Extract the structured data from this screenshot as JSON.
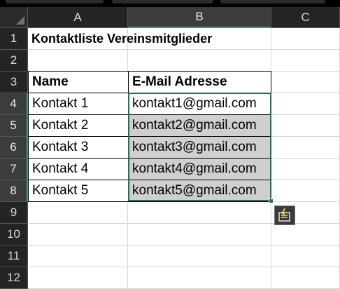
{
  "columns": [
    "A",
    "B",
    "C"
  ],
  "rows": [
    "1",
    "2",
    "3",
    "4",
    "5",
    "6",
    "7",
    "8",
    "9",
    "10",
    "11",
    "12"
  ],
  "selected_column": "B",
  "selected_rows": [
    "4",
    "5",
    "6",
    "7",
    "8"
  ],
  "sheet": {
    "title": "Kontaktliste Vereinsmitglieder",
    "headers": {
      "name": "Name",
      "email": "E-Mail Adresse"
    },
    "contacts": [
      {
        "name": "Kontakt 1",
        "email": "kontakt1@gmail.com"
      },
      {
        "name": "Kontakt 2",
        "email": "kontakt2@gmail.com"
      },
      {
        "name": "Kontakt 3",
        "email": "kontakt3@gmail.com"
      },
      {
        "name": "Kontakt 4",
        "email": "kontakt4@gmail.com"
      },
      {
        "name": "Kontakt 5",
        "email": "kontakt5@gmail.com"
      }
    ]
  },
  "quick_analysis": {
    "icon": "quick-analysis-icon"
  },
  "colors": {
    "selection_border": "#217346",
    "header_background": "#242424",
    "selected_header_background": "#3c3c3c",
    "filled_cell_background": "#cfcfcf"
  }
}
